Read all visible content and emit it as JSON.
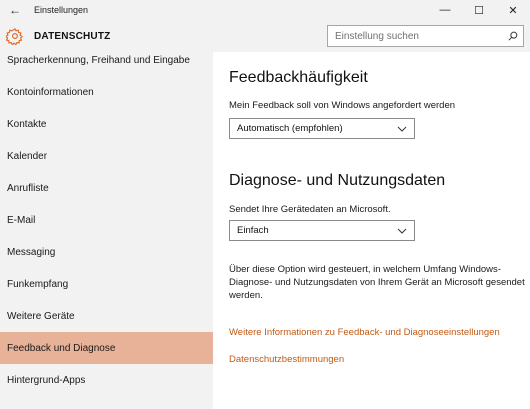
{
  "window": {
    "title": "Einstellungen",
    "back_glyph": "←",
    "minimize_glyph": "—",
    "maximize_glyph": "☐",
    "close_glyph": "✕"
  },
  "header": {
    "title": "DATENSCHUTZ",
    "icon": "gear-icon",
    "accent": "#e06d2e"
  },
  "search": {
    "placeholder": "Einstellung suchen",
    "value": ""
  },
  "sidebar": {
    "items": [
      {
        "label": "Spracherkennung, Freihand und Eingabe",
        "active": false
      },
      {
        "label": "Kontoinformationen",
        "active": false
      },
      {
        "label": "Kontakte",
        "active": false
      },
      {
        "label": "Kalender",
        "active": false
      },
      {
        "label": "Anrufliste",
        "active": false
      },
      {
        "label": "E-Mail",
        "active": false
      },
      {
        "label": "Messaging",
        "active": false
      },
      {
        "label": "Funkempfang",
        "active": false
      },
      {
        "label": "Weitere Geräte",
        "active": false
      },
      {
        "label": "Feedback und Diagnose",
        "active": true
      },
      {
        "label": "Hintergrund-Apps",
        "active": false
      }
    ],
    "active_color": "#e8b298"
  },
  "main": {
    "feedback": {
      "title": "Feedbackhäufigkeit",
      "label": "Mein Feedback soll von Windows angefordert werden",
      "selected": "Automatisch (empfohlen)"
    },
    "diagnose": {
      "title": "Diagnose- und Nutzungsdaten",
      "label": "Sendet Ihre Gerätedaten an Microsoft.",
      "selected": "Einfach",
      "description": "Über diese Option wird gesteuert, in welchem Umfang Windows-Diagnose- und Nutzungsdaten von Ihrem Gerät an Microsoft gesendet werden."
    },
    "links": {
      "more_info": "Weitere Informationen zu Feedback- und Diagnoseeinstellungen",
      "privacy": "Datenschutzbestimmungen",
      "link_color": "#c35a14"
    }
  }
}
